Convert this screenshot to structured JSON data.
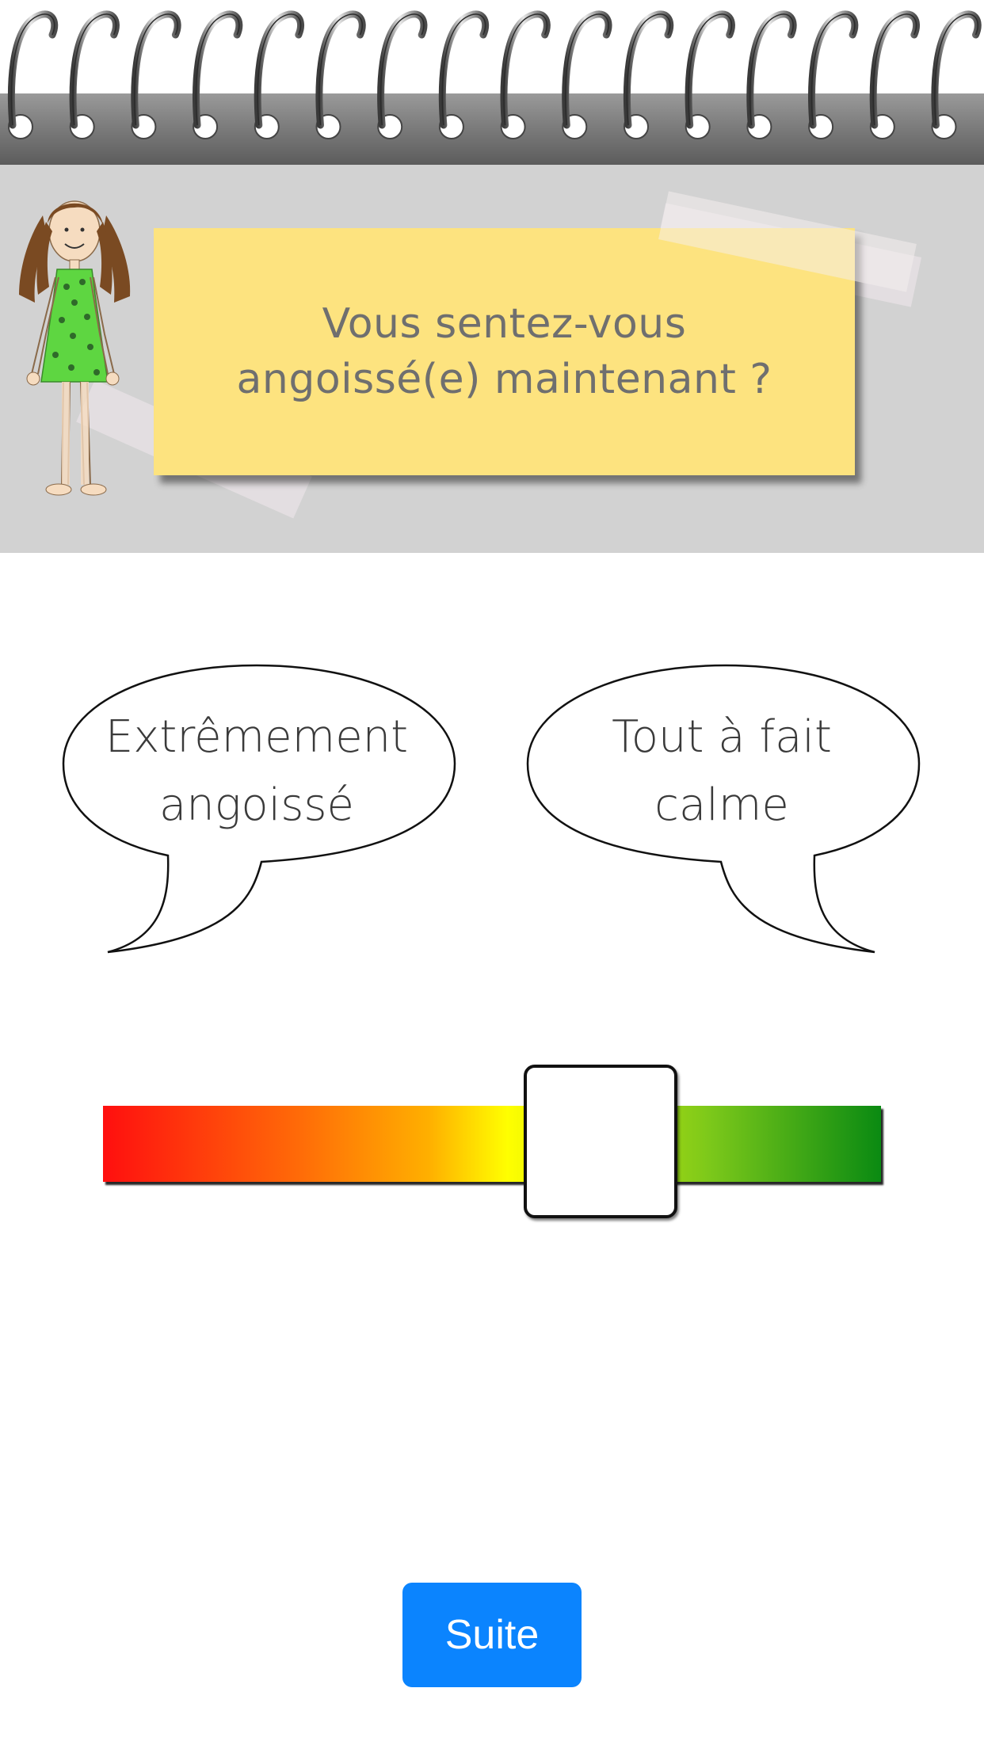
{
  "question": {
    "text": "Vous sentez-vous\nangoissé(e) maintenant ?"
  },
  "scale": {
    "left_label": "Extrêmement\nangoissé",
    "right_label": "Tout à fait\ncalme",
    "value": 0.64,
    "gradient_colors": [
      "#ff0f0f",
      "#ff6a08",
      "#ffb000",
      "#ffff00",
      "#7cc81a",
      "#0a8a12"
    ]
  },
  "actions": {
    "next_label": "Suite",
    "accent_color": "#0b84fe"
  },
  "header": {
    "background_color": "#d2d2d2",
    "note_color": "#fde37f",
    "illustration": "girl-in-green-dress-illustration"
  }
}
